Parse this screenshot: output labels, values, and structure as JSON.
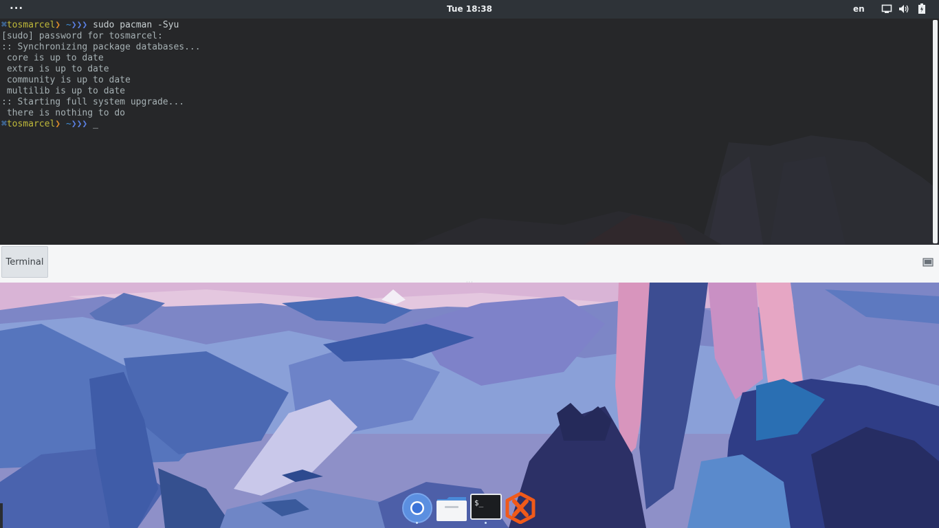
{
  "topbar": {
    "activities_label": "···",
    "clock": "Tue 18:38",
    "language": "en",
    "icons": [
      "screen-icon",
      "volume-icon",
      "battery-icon"
    ]
  },
  "terminal": {
    "prompt": {
      "symbol": "⌘",
      "user": "tosmarcel",
      "bracket": "❯",
      "path": "~",
      "arrows": "❯❯❯"
    },
    "command": "sudo pacman -Syu",
    "output": [
      "[sudo] password for tosmarcel:",
      ":: Synchronizing package databases...",
      " core is up to date",
      " extra is up to date",
      " community is up to date",
      " multilib is up to date",
      ":: Starting full system upgrade...",
      " there is nothing to do"
    ],
    "cursor": "_"
  },
  "taskbar": {
    "window_button_label": "Terminal",
    "grip": "···"
  },
  "dock": {
    "apps": [
      "chromium-icon",
      "files-icon",
      "terminal-icon",
      "xampp-icon"
    ]
  },
  "colors": {
    "topbar_bg": "#2e3338",
    "terminal_bg": "#262729",
    "taskbar_bg": "#f5f6f7",
    "prompt_user": "#c0ba3a"
  }
}
